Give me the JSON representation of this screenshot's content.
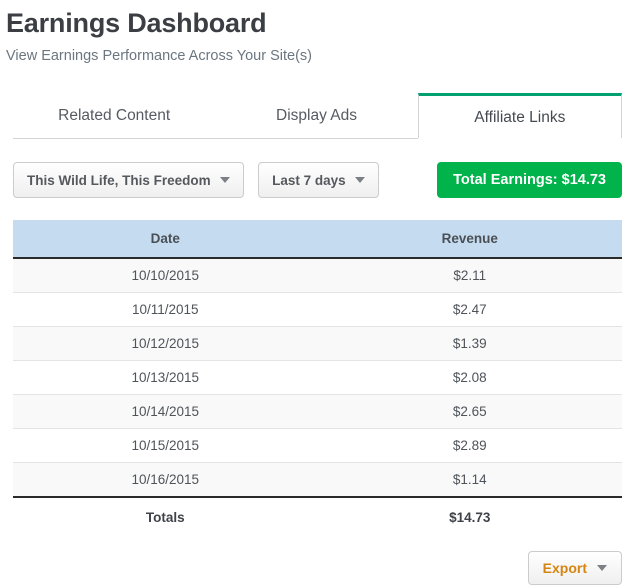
{
  "header": {
    "title": "Earnings Dashboard",
    "subtitle": "View Earnings Performance Across Your Site(s)"
  },
  "tabs": [
    {
      "label": "Related Content",
      "active": false
    },
    {
      "label": "Display Ads",
      "active": false
    },
    {
      "label": "Affiliate Links",
      "active": true
    }
  ],
  "controls": {
    "site_selector": {
      "value": "This Wild Life, This Freedom",
      "icon": "caret-down-icon"
    },
    "date_range_selector": {
      "value": "Last 7 days",
      "icon": "caret-down-icon"
    },
    "total_earnings_badge": "Total Earnings: $14.73"
  },
  "table": {
    "columns": [
      "Date",
      "Revenue"
    ],
    "rows": [
      [
        "10/10/2015",
        "$2.11"
      ],
      [
        "10/11/2015",
        "$2.47"
      ],
      [
        "10/12/2015",
        "$1.39"
      ],
      [
        "10/13/2015",
        "$2.08"
      ],
      [
        "10/14/2015",
        "$2.65"
      ],
      [
        "10/15/2015",
        "$2.89"
      ],
      [
        "10/16/2015",
        "$1.14"
      ]
    ],
    "totals": [
      "Totals",
      "$14.73"
    ]
  },
  "footer": {
    "export_label": "Export",
    "export_icon": "caret-down-icon"
  },
  "colors": {
    "tab_accent_green": "#00a070",
    "badge_green": "#00b34a",
    "table_header_blue": "#c5dcf0",
    "export_orange": "#d58512",
    "subtitle_gray": "#6b7680"
  }
}
